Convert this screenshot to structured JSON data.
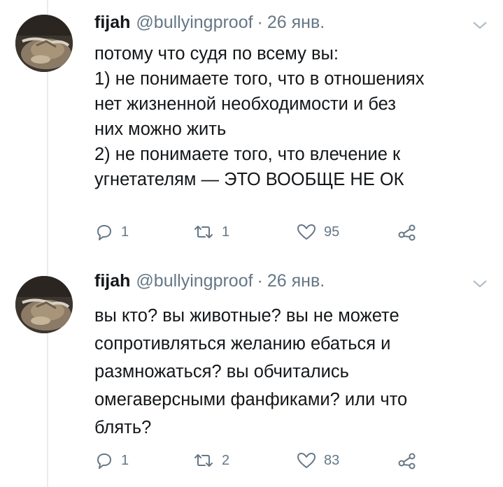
{
  "tweets": [
    {
      "author_name": "fijah",
      "author_handle": "@bullyingproof",
      "separator": "·",
      "date": "26 янв.",
      "lines": [
        "потому что судя по всему вы:",
        "1) не понимаете того, что в отношениях",
        "нет жизненной необходимости и без",
        "них можно жить",
        "2) не понимаете того, что влечение к",
        "угнетателям — ЭТО ВООБЩЕ НЕ ОК"
      ],
      "replies": "1",
      "retweets": "1",
      "likes": "95"
    },
    {
      "author_name": "fijah",
      "author_handle": "@bullyingproof",
      "separator": "·",
      "date": "26 янв.",
      "lines": [
        "вы кто? вы животные? вы не можете",
        "сопротивляться желанию ебаться и",
        "размножаться? вы обчитались",
        "омегаверсными фанфиками? или что",
        "блять?"
      ],
      "replies": "1",
      "retweets": "2",
      "likes": "83"
    }
  ],
  "icons": {
    "reply": "reply-icon",
    "retweet": "retweet-icon",
    "like": "heart-icon",
    "share": "share-icon",
    "menu": "chevron-down-icon"
  },
  "colors": {
    "text": "#14171a",
    "muted": "#657786",
    "thread_line": "#e6ecf0"
  }
}
